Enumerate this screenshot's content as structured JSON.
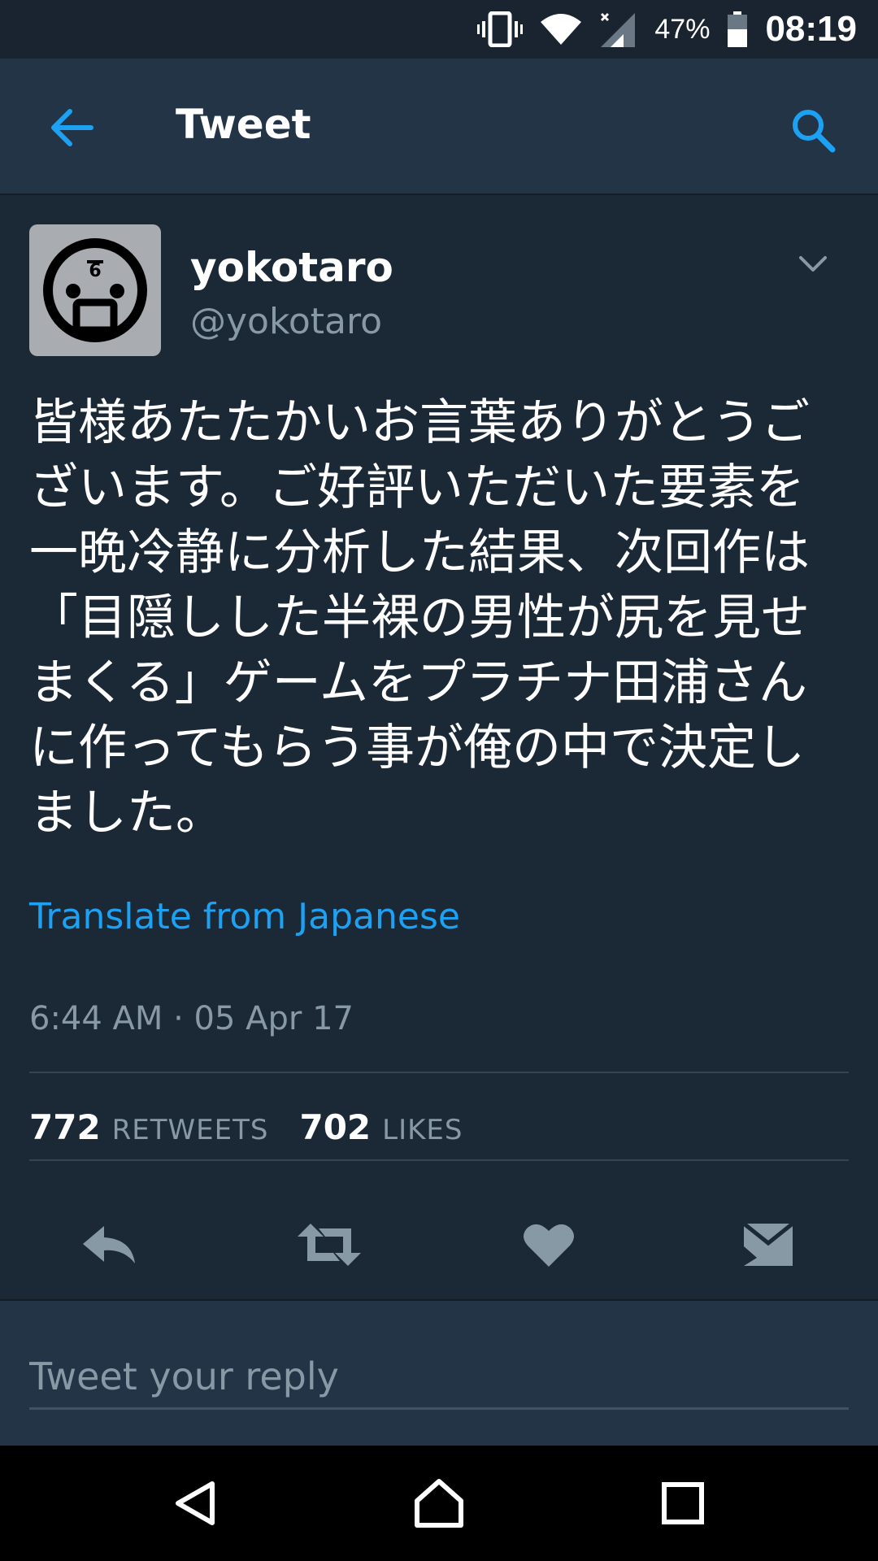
{
  "status_bar": {
    "battery_percent": "47%",
    "time": "08:19",
    "icons": [
      "vibrate-icon",
      "wifi-icon",
      "cell-signal-icon",
      "battery-icon"
    ]
  },
  "app_bar": {
    "title": "Tweet",
    "back_icon": "arrow-left-icon",
    "search_icon": "search-icon",
    "accent_color": "#1da1f2"
  },
  "tweet": {
    "display_name": "yokotaro",
    "handle": "@yokotaro",
    "text": "皆様あたたかいお言葉ありがとうございます。ご好評いただいた要素を一晩冷静に分析した結果、次回作は「目隠しした半裸の男性が尻を見せまくる」ゲームをプラチナ田浦さんに作ってもらう事が俺の中で決定しました。",
    "translate_label": "Translate from Japanese",
    "timestamp": "6:44 AM · 05 Apr 17",
    "retweet_count": "772",
    "retweet_label": "RETWEETS",
    "like_count": "702",
    "like_label": "LIKES",
    "actions": [
      "reply-icon",
      "retweet-icon",
      "heart-icon",
      "message-icon"
    ]
  },
  "reply": {
    "placeholder": "Tweet your reply"
  },
  "nav": {
    "icons": [
      "back-triangle-icon",
      "home-icon",
      "recents-icon"
    ]
  }
}
